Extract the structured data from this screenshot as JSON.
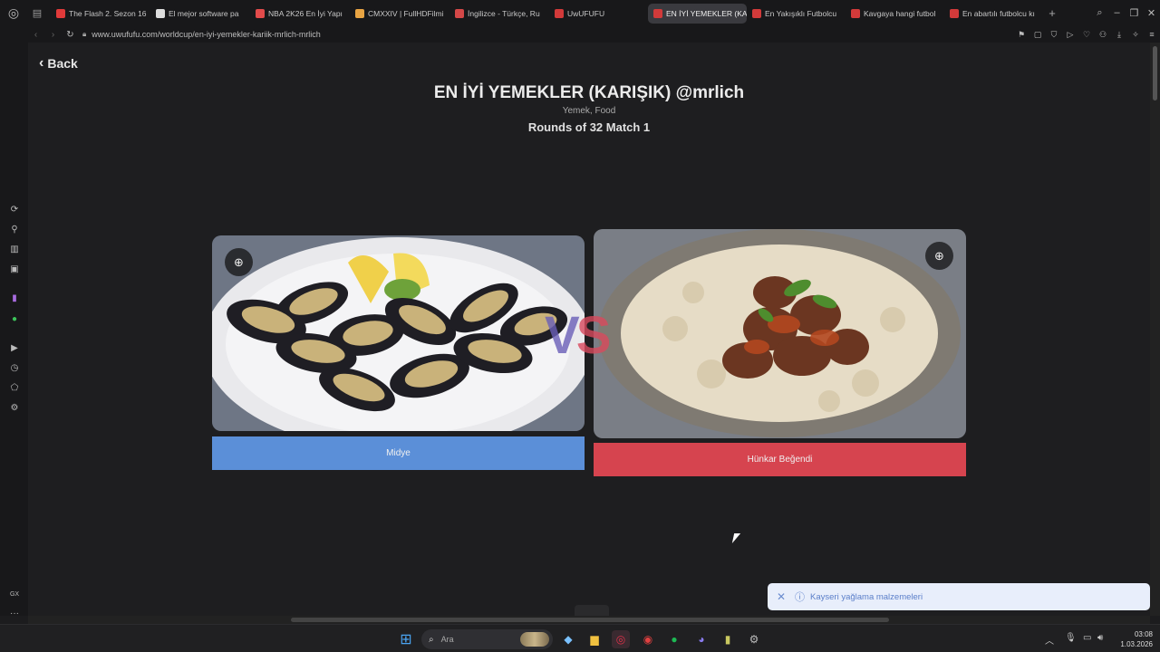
{
  "browser": {
    "tabs": [
      {
        "title": "The Flash 2. Sezon 16",
        "favicon_color": "#e03a3a",
        "favicon_icon": "youtube-icon"
      },
      {
        "title": "El mejor software pa",
        "favicon_color": "#dddddd",
        "favicon_icon": "site-icon"
      },
      {
        "title": "NBA 2K26 En İyi Yapı",
        "favicon_color": "#e24b4b",
        "favicon_icon": "site-icon"
      },
      {
        "title": "CMXXIV | FullHDFilmi",
        "favicon_color": "#e8a443",
        "favicon_icon": "site-icon"
      },
      {
        "title": "İngilizce - Türkçe, Ru",
        "favicon_color": "#d44848",
        "favicon_icon": "site-icon"
      },
      {
        "title": "UwUFUFU",
        "favicon_color": "#d23a3a",
        "favicon_icon": "uwufufu-icon"
      },
      {
        "title": "EN İYİ YEMEKLER (KARIŞ",
        "favicon_color": "#d23a3a",
        "favicon_icon": "uwufufu-icon",
        "active": true
      },
      {
        "title": "En Yakışıklı Futbolcu",
        "favicon_color": "#d23a3a",
        "favicon_icon": "uwufufu-icon"
      },
      {
        "title": "Kavgaya hangi futbol",
        "favicon_color": "#d23a3a",
        "favicon_icon": "uwufufu-icon"
      },
      {
        "title": "En abartılı futbolcu kı",
        "favicon_color": "#d23a3a",
        "favicon_icon": "uwufufu-icon"
      }
    ],
    "url": "www.uwufufu.com/worldcup/en-iyi-yemekler-kariik-mrlich-mrlich"
  },
  "page": {
    "back_label": "Back",
    "title": "EN İYİ YEMEKLER (KARIŞIK) @mrlich",
    "subtitle": "Yemek, Food",
    "round": "Rounds of 32 Match 1",
    "vs_v": "V",
    "vs_s": "S",
    "left_choice": {
      "label": "Midye",
      "color": "#5b8fd8"
    },
    "right_choice": {
      "label": "Hünkar Beğendi",
      "color": "#d6444f"
    }
  },
  "toast": {
    "text": "Kayseri yağlama malzemeleri"
  },
  "taskbar": {
    "search_placeholder": "Ara",
    "time": "03:08",
    "date": "1.03.2026"
  },
  "sidebar": {
    "bottom_label": "GX"
  }
}
